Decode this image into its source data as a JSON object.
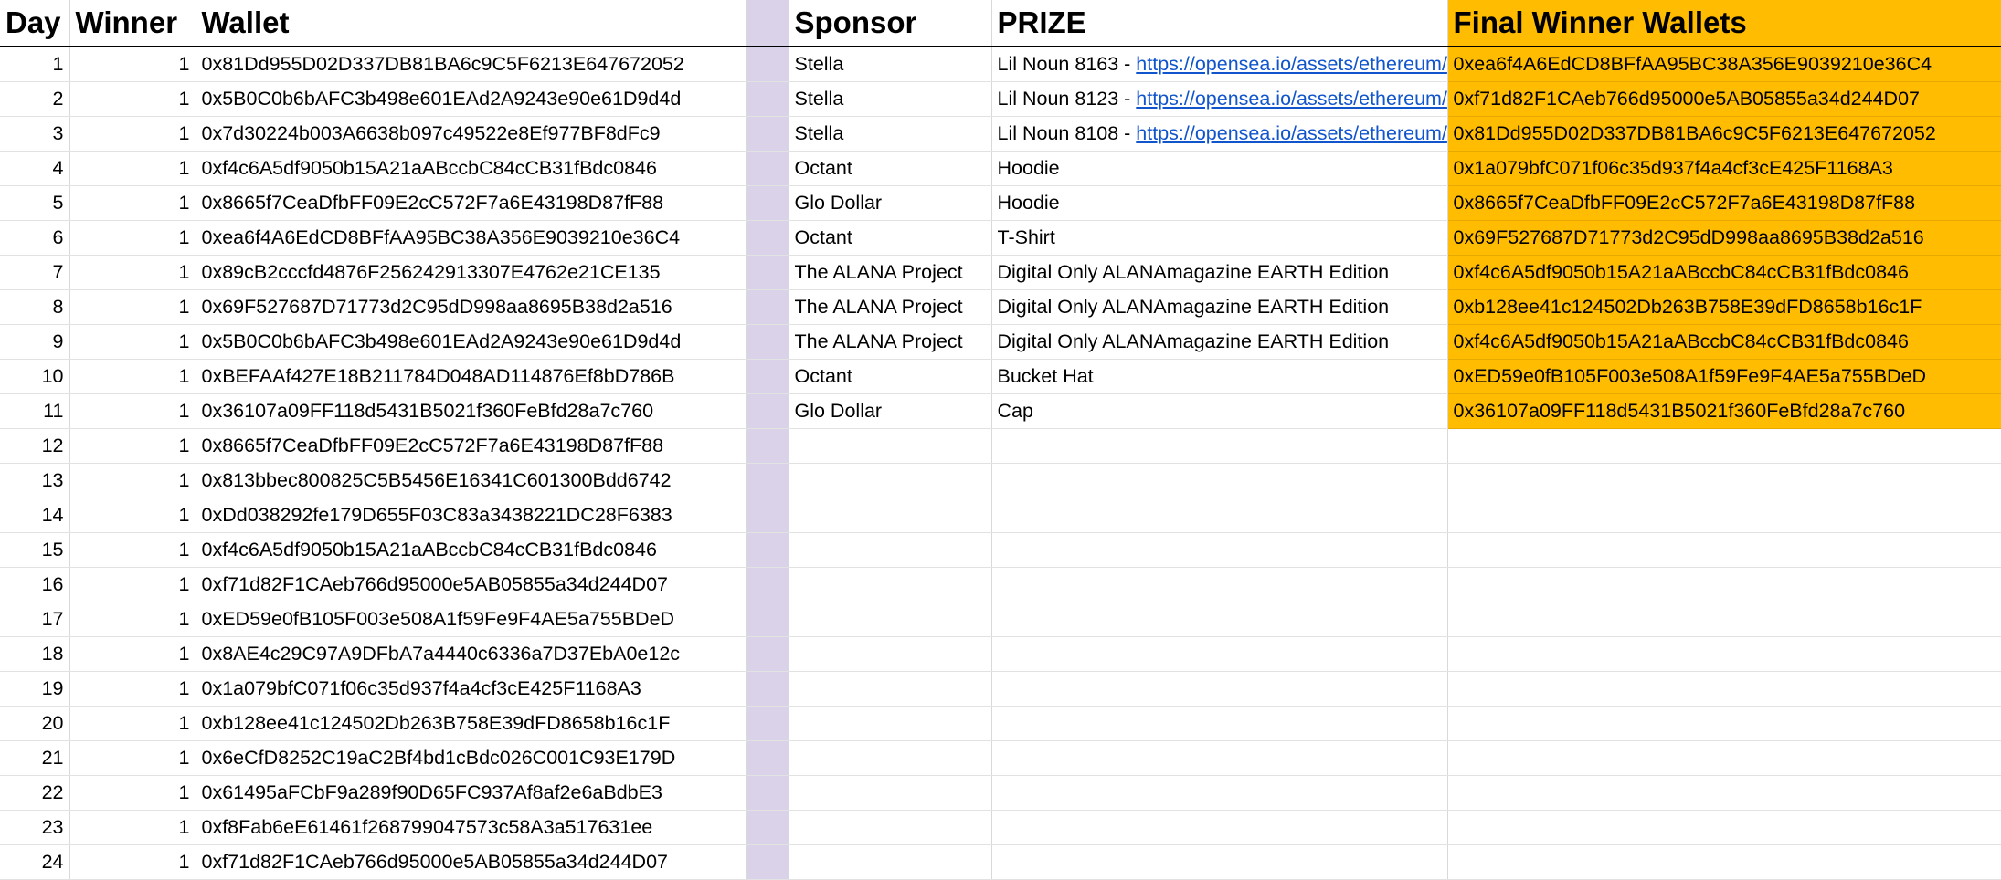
{
  "headers": {
    "day": "Day",
    "winner": "Winner",
    "wallet": "Wallet",
    "sponsor": "Sponsor",
    "prize": "PRIZE",
    "final": "Final Winner Wallets"
  },
  "colors": {
    "spacer": "#d9d2e9",
    "final_highlight": "#ffbc00",
    "link": "#1155cc"
  },
  "rows": [
    {
      "day": "1",
      "winner": "1",
      "wallet": "0x81Dd955D02D337DB81BA6c9C5F6213E647672052",
      "sponsor": "Stella",
      "prize_text": "Lil Noun 8163 - ",
      "prize_link": "https://opensea.io/assets/ethereum/",
      "final": "0xea6f4A6EdCD8BFfAA95BC38A356E9039210e36C4"
    },
    {
      "day": "2",
      "winner": "1",
      "wallet": "0x5B0C0b6bAFC3b498e601EAd2A9243e90e61D9d4d",
      "sponsor": "Stella",
      "prize_text": "Lil Noun 8123 - ",
      "prize_link": "https://opensea.io/assets/ethereum/",
      "final": "0xf71d82F1CAeb766d95000e5AB05855a34d244D07"
    },
    {
      "day": "3",
      "winner": "1",
      "wallet": "0x7d30224b003A6638b097c49522e8Ef977BF8dFc9",
      "sponsor": "Stella",
      "prize_text": "Lil Noun 8108 - ",
      "prize_link": "https://opensea.io/assets/ethereum/",
      "final": "0x81Dd955D02D337DB81BA6c9C5F6213E647672052"
    },
    {
      "day": "4",
      "winner": "1",
      "wallet": "0xf4c6A5df9050b15A21aABccbC84cCB31fBdc0846",
      "sponsor": "Octant",
      "prize_text": "Hoodie",
      "prize_link": "",
      "final": "0x1a079bfC071f06c35d937f4a4cf3cE425F1168A3"
    },
    {
      "day": "5",
      "winner": "1",
      "wallet": "0x8665f7CeaDfbFF09E2cC572F7a6E43198D87fF88",
      "sponsor": "Glo Dollar",
      "prize_text": "Hoodie",
      "prize_link": "",
      "final": "0x8665f7CeaDfbFF09E2cC572F7a6E43198D87fF88"
    },
    {
      "day": "6",
      "winner": "1",
      "wallet": "0xea6f4A6EdCD8BFfAA95BC38A356E9039210e36C4",
      "sponsor": "Octant",
      "prize_text": "T-Shirt",
      "prize_link": "",
      "final": "0x69F527687D71773d2C95dD998aa8695B38d2a516"
    },
    {
      "day": "7",
      "winner": "1",
      "wallet": "0x89cB2cccfd4876F256242913307E4762e21CE135",
      "sponsor": "The ALANA Project",
      "prize_text": "Digital Only ALANAmagazine EARTH Edition",
      "prize_link": "",
      "final": "0xf4c6A5df9050b15A21aABccbC84cCB31fBdc0846"
    },
    {
      "day": "8",
      "winner": "1",
      "wallet": "0x69F527687D71773d2C95dD998aa8695B38d2a516",
      "sponsor": "The ALANA Project",
      "prize_text": "Digital Only ALANAmagazine EARTH Edition",
      "prize_link": "",
      "final": "0xb128ee41c124502Db263B758E39dFD8658b16c1F"
    },
    {
      "day": "9",
      "winner": "1",
      "wallet": "0x5B0C0b6bAFC3b498e601EAd2A9243e90e61D9d4d",
      "sponsor": "The ALANA Project",
      "prize_text": "Digital Only ALANAmagazine EARTH Edition",
      "prize_link": "",
      "final": "0xf4c6A5df9050b15A21aABccbC84cCB31fBdc0846"
    },
    {
      "day": "10",
      "winner": "1",
      "wallet": "0xBEFAAf427E18B211784D048AD114876Ef8bD786B",
      "sponsor": "Octant",
      "prize_text": "Bucket Hat",
      "prize_link": "",
      "final": "0xED59e0fB105F003e508A1f59Fe9F4AE5a755BDeD"
    },
    {
      "day": "11",
      "winner": "1",
      "wallet": "0x36107a09FF118d5431B5021f360FeBfd28a7c760",
      "sponsor": "Glo Dollar",
      "prize_text": "Cap",
      "prize_link": "",
      "final": "0x36107a09FF118d5431B5021f360FeBfd28a7c760"
    },
    {
      "day": "12",
      "winner": "1",
      "wallet": "0x8665f7CeaDfbFF09E2cC572F7a6E43198D87fF88",
      "sponsor": "",
      "prize_text": "",
      "prize_link": "",
      "final": ""
    },
    {
      "day": "13",
      "winner": "1",
      "wallet": "0x813bbec800825C5B5456E16341C601300Bdd6742",
      "sponsor": "",
      "prize_text": "",
      "prize_link": "",
      "final": ""
    },
    {
      "day": "14",
      "winner": "1",
      "wallet": "0xDd038292fe179D655F03C83a3438221DC28F6383",
      "sponsor": "",
      "prize_text": "",
      "prize_link": "",
      "final": ""
    },
    {
      "day": "15",
      "winner": "1",
      "wallet": "0xf4c6A5df9050b15A21aABccbC84cCB31fBdc0846",
      "sponsor": "",
      "prize_text": "",
      "prize_link": "",
      "final": ""
    },
    {
      "day": "16",
      "winner": "1",
      "wallet": "0xf71d82F1CAeb766d95000e5AB05855a34d244D07",
      "sponsor": "",
      "prize_text": "",
      "prize_link": "",
      "final": ""
    },
    {
      "day": "17",
      "winner": "1",
      "wallet": "0xED59e0fB105F003e508A1f59Fe9F4AE5a755BDeD",
      "sponsor": "",
      "prize_text": "",
      "prize_link": "",
      "final": ""
    },
    {
      "day": "18",
      "winner": "1",
      "wallet": "0x8AE4c29C97A9DFbA7a4440c6336a7D37EbA0e12c",
      "sponsor": "",
      "prize_text": "",
      "prize_link": "",
      "final": ""
    },
    {
      "day": "19",
      "winner": "1",
      "wallet": "0x1a079bfC071f06c35d937f4a4cf3cE425F1168A3",
      "sponsor": "",
      "prize_text": "",
      "prize_link": "",
      "final": ""
    },
    {
      "day": "20",
      "winner": "1",
      "wallet": "0xb128ee41c124502Db263B758E39dFD8658b16c1F",
      "sponsor": "",
      "prize_text": "",
      "prize_link": "",
      "final": ""
    },
    {
      "day": "21",
      "winner": "1",
      "wallet": "0x6eCfD8252C19aC2Bf4bd1cBdc026C001C93E179D",
      "sponsor": "",
      "prize_text": "",
      "prize_link": "",
      "final": ""
    },
    {
      "day": "22",
      "winner": "1",
      "wallet": "0x61495aFCbF9a289f90D65FC937Af8af2e6aBdbE3",
      "sponsor": "",
      "prize_text": "",
      "prize_link": "",
      "final": ""
    },
    {
      "day": "23",
      "winner": "1",
      "wallet": "0xf8Fab6eE61461f268799047573c58A3a517631ee",
      "sponsor": "",
      "prize_text": "",
      "prize_link": "",
      "final": ""
    },
    {
      "day": "24",
      "winner": "1",
      "wallet": "0xf71d82F1CAeb766d95000e5AB05855a34d244D07",
      "sponsor": "",
      "prize_text": "",
      "prize_link": "",
      "final": ""
    }
  ]
}
